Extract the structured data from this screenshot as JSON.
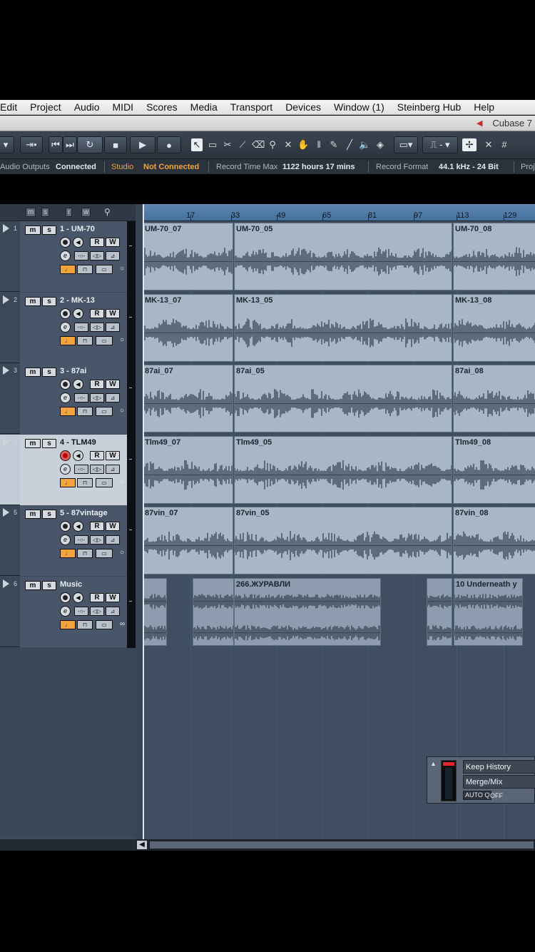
{
  "app": {
    "title": "Cubase 7"
  },
  "menu": [
    "Edit",
    "Project",
    "Audio",
    "MIDI",
    "Scores",
    "Media",
    "Transport",
    "Devices",
    "Window (1)",
    "Steinberg Hub",
    "Help"
  ],
  "status": {
    "audio_outputs_label": "Audio Outputs",
    "audio_outputs_value": "Connected",
    "studio_label": "Studio",
    "studio_value": "Not Connected",
    "record_time_label": "Record Time Max",
    "record_time_value": "1122 hours 17 mins",
    "record_format_label": "Record Format",
    "record_format_value": "44.1 kHz - 24 Bit",
    "project_label": "Proj"
  },
  "ruler": [
    "17",
    "33",
    "49",
    "65",
    "81",
    "97",
    "113",
    "129"
  ],
  "header_buttons": [
    "m",
    "s",
    "r",
    "w"
  ],
  "track_buttons": {
    "mute": "m",
    "solo": "s",
    "read": "R",
    "write": "W"
  },
  "tracks": [
    {
      "num": "1",
      "name": "1 - UM-70",
      "events": [
        "UM-70_07",
        "UM-70_05",
        "UM-70_08"
      ],
      "armed": false
    },
    {
      "num": "2",
      "name": "2 - MK-13",
      "events": [
        "MK-13_07",
        "MK-13_05",
        "MK-13_08"
      ],
      "armed": false
    },
    {
      "num": "3",
      "name": "3 - 87ai",
      "events": [
        "87ai_07",
        "87ai_05",
        "87ai_08"
      ],
      "armed": false
    },
    {
      "num": "4",
      "name": "4 - TLM49",
      "events": [
        "Tlm49_07",
        "Tlm49_05",
        "Tlm49_08"
      ],
      "armed": true
    },
    {
      "num": "5",
      "name": "5 - 87vintage",
      "events": [
        "87vin_07",
        "87vin_05",
        "87vin_08"
      ],
      "armed": false
    },
    {
      "num": "6",
      "name": "Music",
      "events": [
        "266.ЖУРАВЛИ",
        "10 Underneath y"
      ],
      "armed": false
    }
  ],
  "history_panel": {
    "keep_history": "Keep History",
    "merge_mix": "Merge/Mix",
    "autoq": "AUTO Q",
    "autoq_value": "OFF"
  }
}
